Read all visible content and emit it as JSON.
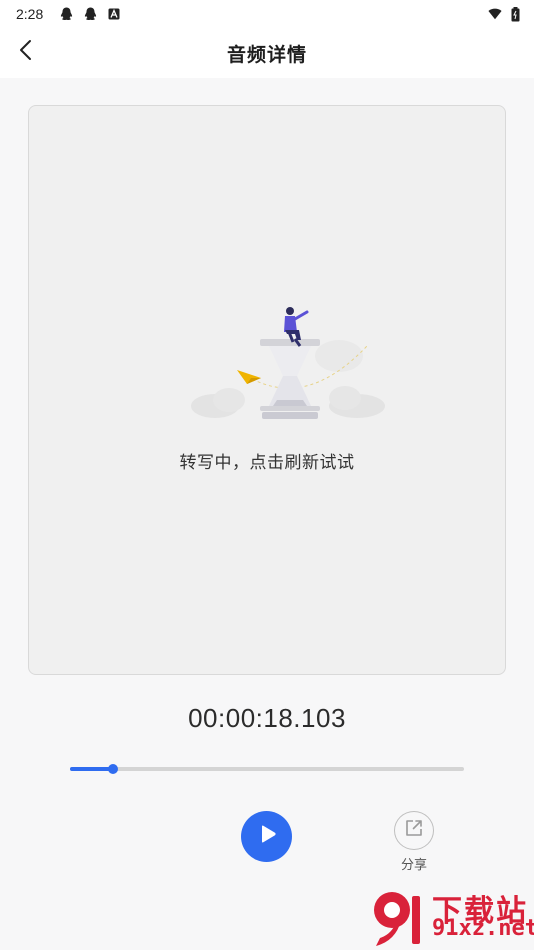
{
  "status_bar": {
    "time": "2:28",
    "left_icons": [
      "qq-icon",
      "qq-icon",
      "a-badge-icon"
    ],
    "right_icons": [
      "wifi-icon",
      "battery-icon"
    ]
  },
  "header": {
    "title": "音频详情",
    "back_icon": "chevron-left-icon"
  },
  "transcript_card": {
    "illustration": "hourglass-loading-illustration",
    "message": "转写中，点击刷新试试"
  },
  "player": {
    "current_time": "00:00:18.103",
    "progress": 0.11,
    "play_icon": "play-icon",
    "share_label": "分享",
    "share_icon": "share-icon"
  },
  "watermark": {
    "name": "下载站",
    "site": "91xz.net",
    "logo_number": "9"
  },
  "colors": {
    "accent": "#2f6cf0",
    "watermark": "#d9223a",
    "background": "#f7f7f8"
  }
}
